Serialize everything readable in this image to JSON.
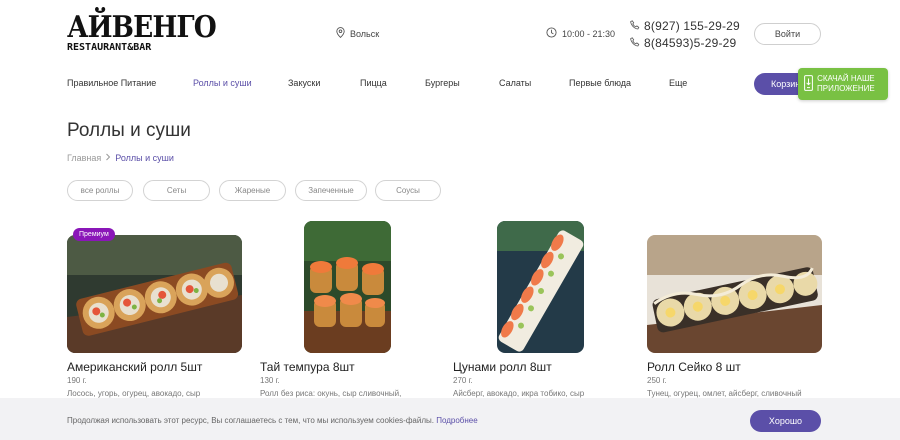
{
  "header": {
    "logo_main": "АЙВЕНГО",
    "logo_sub": "RESTAURANT&BAR",
    "city": "Вольск",
    "hours": "10:00 - 21:30",
    "phones": [
      "8(927) 155-29-29",
      "8(84593)5-29-29"
    ],
    "login_label": "Войти"
  },
  "nav": {
    "items": [
      {
        "label": "Правильное Питание",
        "active": false
      },
      {
        "label": "Роллы и суши",
        "active": true
      },
      {
        "label": "Закуски",
        "active": false
      },
      {
        "label": "Пицца",
        "active": false
      },
      {
        "label": "Бургеры",
        "active": false
      },
      {
        "label": "Салаты",
        "active": false
      },
      {
        "label": "Первые блюда",
        "active": false
      },
      {
        "label": "Еще",
        "active": false
      }
    ],
    "cart_label": "Корзина",
    "app_badge": [
      "СКАЧАЙ НАШЕ",
      "ПРИЛОЖЕНИЕ"
    ]
  },
  "page": {
    "title": "Роллы и суши",
    "breadcrumb": [
      "Главная",
      "Роллы и суши"
    ]
  },
  "filters": [
    "все роллы",
    "Сеты",
    "Жареные",
    "Запеченные",
    "Соусы"
  ],
  "products": [
    {
      "title": "Американский ролл 5шт",
      "weight": "190 г.",
      "desc": "Лосось, угорь, огурец, авокадо, сыр",
      "badge": "Премиум"
    },
    {
      "title": "Тай темпура 8шт",
      "weight": "130 г.",
      "desc": "Ролл без риса: окунь, сыр сливочный,",
      "badge": ""
    },
    {
      "title": "Цунами ролл 8шт",
      "weight": "270 г.",
      "desc": "Айсберг, авокадо, икра тобико, сыр",
      "badge": ""
    },
    {
      "title": "Ролл Сейко 8 шт",
      "weight": "250 г.",
      "desc": "Тунец, огурец, омлет, айсберг, сливочный",
      "badge": ""
    }
  ],
  "cookie": {
    "text": "Продолжая использовать этот ресурс, Вы соглашаетесь с тем, что мы используем cookies-файлы.",
    "more": "Подробнее",
    "ok_label": "Хорошо"
  },
  "colors": {
    "accent": "#5b4fa8",
    "premium": "#8a16b8",
    "app_badge": "#79c143"
  }
}
